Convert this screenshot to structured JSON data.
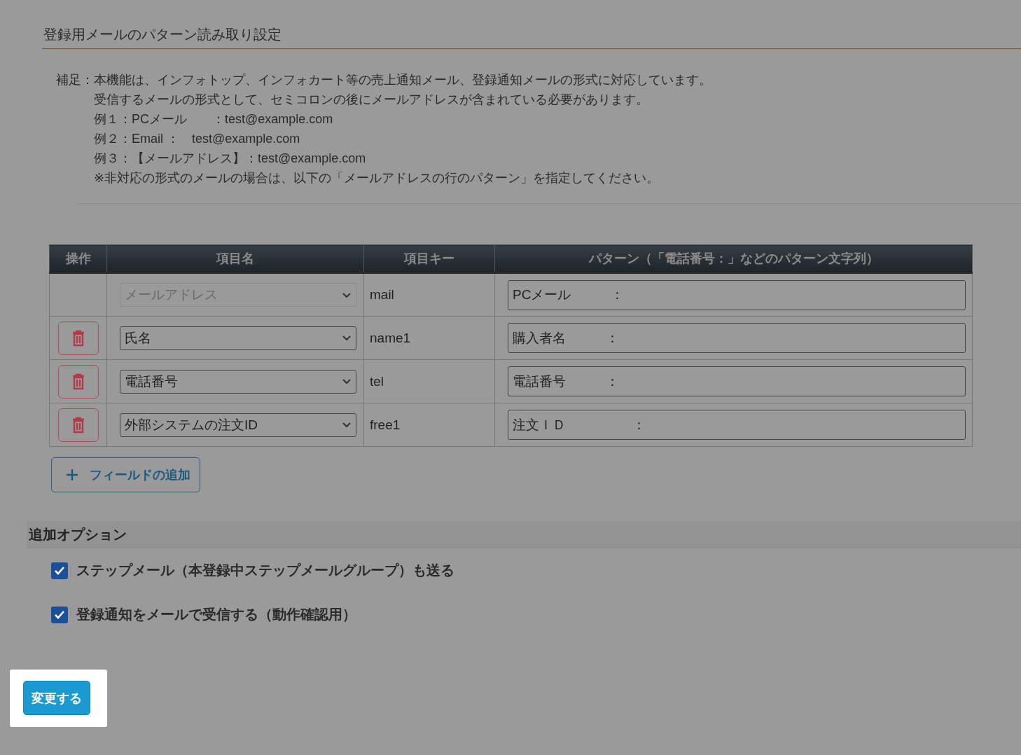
{
  "section_title": "登録用メールのパターン読み取り設定",
  "note": {
    "label": "補足：",
    "lines": [
      "本機能は、インフォトップ、インフォカート等の売上通知メール、登録通知メールの形式に対応しています。",
      "受信するメールの形式として、セミコロンの後にメールアドレスが含まれている必要があります。",
      "例１：PCメール　　：test@example.com",
      "例２：Email ：　test@example.com",
      "例３：【メールアドレス】：test@example.com",
      "※非対応の形式のメールの場合は、以下の「メールアドレスの行のパターン」を指定してください。"
    ]
  },
  "table": {
    "columns": [
      "操作",
      "項目名",
      "項目キー",
      "パターン（「電話番号：」などのパターン文字列）"
    ],
    "rows": [
      {
        "deletable": false,
        "item": "メールアドレス",
        "disabled": true,
        "key": "mail",
        "pattern": "PCメール　　　："
      },
      {
        "deletable": true,
        "item": "氏名",
        "disabled": false,
        "key": "name1",
        "pattern": "購入者名　　　："
      },
      {
        "deletable": true,
        "item": "電話番号",
        "disabled": false,
        "key": "tel",
        "pattern": "電話番号　　　："
      },
      {
        "deletable": true,
        "item": "外部システムの注文ID",
        "disabled": false,
        "key": "free1",
        "pattern": "注文ＩＤ　　　　　："
      }
    ]
  },
  "add_field_button": "フィールドの追加",
  "options": {
    "title": "追加オプション",
    "items": [
      {
        "label": "ステップメール（本登録中ステップメールグループ）も送る",
        "checked": true
      },
      {
        "label": "登録通知をメールで受信する（動作確認用）",
        "checked": true
      }
    ]
  },
  "submit_button": "変更する"
}
